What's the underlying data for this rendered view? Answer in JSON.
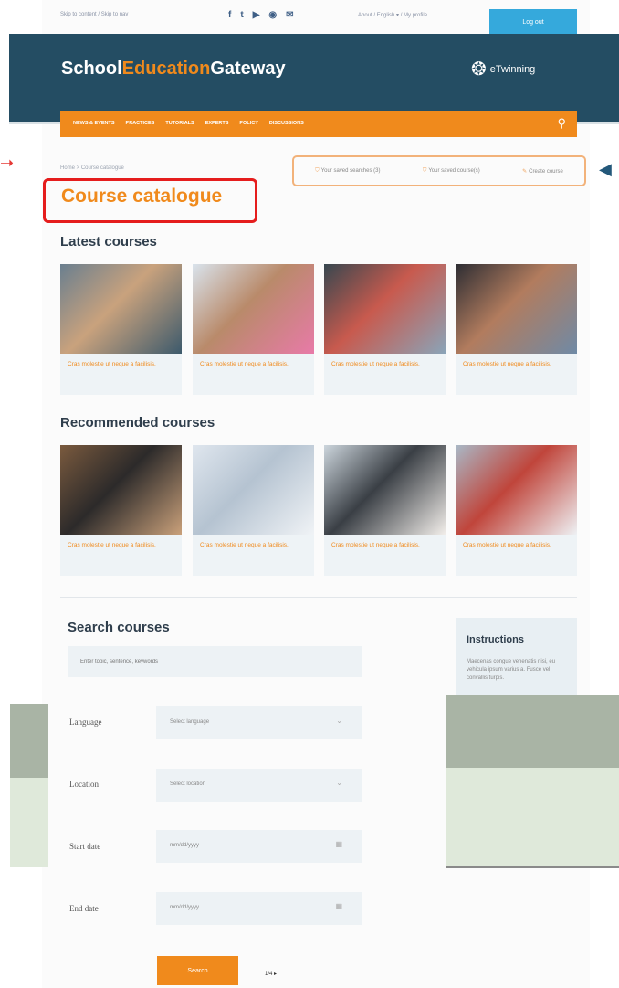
{
  "utility": {
    "skip_links": "Skip to content / Skip to nav",
    "social_icons": [
      "facebook-icon",
      "twitter-icon",
      "youtube-icon",
      "rss-icon",
      "mail-icon"
    ],
    "right_links": "About / English ▾ / My profile",
    "login": "Log out"
  },
  "header": {
    "logo_part1": "School",
    "logo_part2": "Education",
    "logo_part3": "Gateway",
    "partner": "eTwinning"
  },
  "nav": {
    "items": [
      "NEWS & EVENTS",
      "PRACTICES",
      "TUTORIALS",
      "EXPERTS",
      "POLICY",
      "DISCUSSIONS"
    ]
  },
  "breadcrumb": "Home > Course catalogue",
  "page_title": "Course catalogue",
  "saved": {
    "searches": "Your saved searches (3)",
    "courses": "Your saved course(s)",
    "create": "Create course"
  },
  "latest": {
    "heading": "Latest courses",
    "cards": [
      {
        "caption": "Cras molestie ut neque a facilisis."
      },
      {
        "caption": "Cras molestie ut neque a facilisis."
      },
      {
        "caption": "Cras molestie ut neque a facilisis."
      },
      {
        "caption": "Cras molestie ut neque a facilisis."
      }
    ]
  },
  "recommended": {
    "heading": "Recommended courses",
    "cards": [
      {
        "caption": "Cras molestie ut neque a facilisis."
      },
      {
        "caption": "Cras molestie ut neque a facilisis."
      },
      {
        "caption": "Cras molestie ut neque a facilisis."
      },
      {
        "caption": "Cras molestie ut neque a facilisis."
      }
    ]
  },
  "search": {
    "title": "Search courses",
    "keyword_placeholder": "Enter topic, sentence, keywords",
    "language_label": "Language",
    "language_value": "Select language",
    "location_label": "Location",
    "location_value": "Select location",
    "start_label": "Start date",
    "start_value": "mm/dd/yyyy",
    "end_label": "End date",
    "end_value": "mm/dd/yyyy",
    "button": "Search",
    "slide_indicator": "1/4 ▸"
  },
  "instructions": {
    "title": "Instructions",
    "text": "Maecenas congue venenatis nisi, eu vehicula ipsum varius a. Fusce vel convallis turpis."
  },
  "colors": {
    "brand_orange": "#f08a1c",
    "header_blue": "#244d63",
    "login_blue": "#35a9dc",
    "annotation_red": "#e51d1d"
  }
}
